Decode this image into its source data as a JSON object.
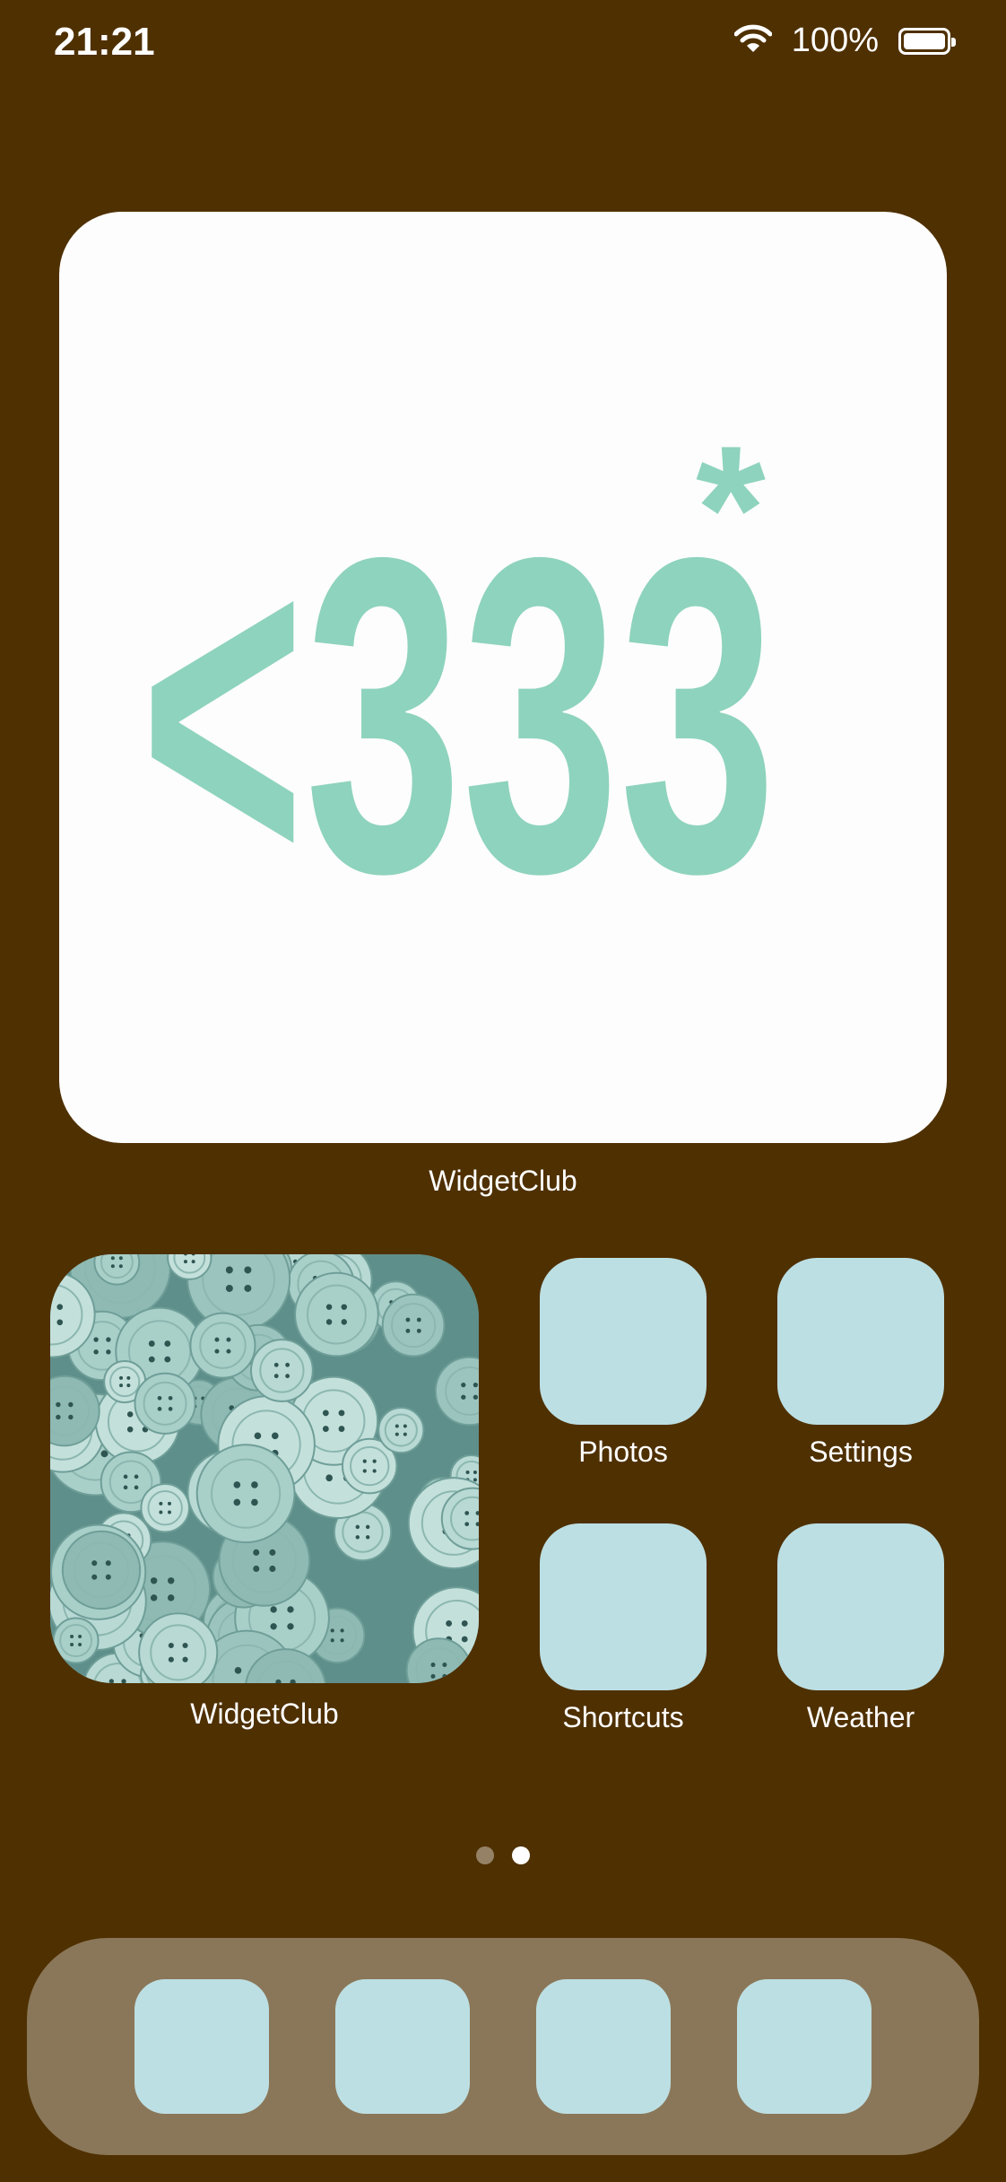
{
  "status_bar": {
    "time": "21:21",
    "battery_percent": "100%",
    "battery_level": 1.0
  },
  "large_widget": {
    "text": "<333",
    "mark": "*",
    "label": "WidgetClub",
    "text_color": "#8ed3bd"
  },
  "photo_widget": {
    "label": "WidgetClub",
    "image": "teal-buttons-photo"
  },
  "apps": [
    {
      "label": "Photos"
    },
    {
      "label": "Settings"
    },
    {
      "label": "Shortcuts"
    },
    {
      "label": "Weather"
    }
  ],
  "page_indicator": {
    "count": 2,
    "current": 2
  },
  "dock": {
    "icon_count": 4
  },
  "colors": {
    "wallpaper": "#4f3001",
    "icon_fill": "#bcdfe3",
    "dock_bg": "#8a7759",
    "widget_bg": "#fdfdfd"
  }
}
